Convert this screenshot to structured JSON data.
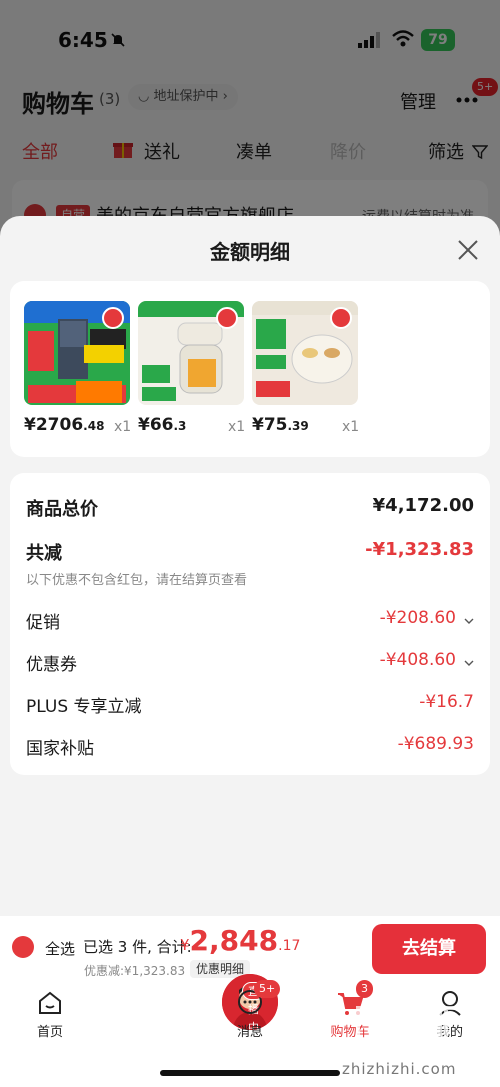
{
  "status_bar": {
    "time": "6:45",
    "battery": "79"
  },
  "cart_header": {
    "title": "购物车",
    "count": "(3)",
    "address_protect": "◡ 地址保护中 ›",
    "manage": "管理",
    "more_badge": "5+"
  },
  "filter_tabs": {
    "all": "全部",
    "gift": "送礼",
    "bundle": "凑单",
    "price_drop": "降价",
    "filter": "筛选"
  },
  "store": {
    "tag": "自营",
    "name": "美的京东自营官方旗舰店",
    "shipping": "运费以结算时为准"
  },
  "sheet": {
    "title": "金额明细",
    "products": [
      {
        "price_int": "¥2706",
        "price_dec": ".48",
        "qty": "x1"
      },
      {
        "price_int": "¥66",
        "price_dec": ".3",
        "qty": "x1"
      },
      {
        "price_int": "¥75",
        "price_dec": ".39",
        "qty": "x1"
      }
    ],
    "details": {
      "total_label": "商品总价",
      "total_value": "¥4,172.00",
      "reduce_label": "共减",
      "reduce_value": "-¥1,323.83",
      "note": "以下优惠不包含红包，请在结算页查看",
      "promo_label": "促销",
      "promo_value": "-¥208.60",
      "coupon_label": "优惠券",
      "coupon_value": "-¥408.60",
      "plus_label": "PLUS 专享立减",
      "plus_value": "-¥16.7",
      "subsidy_label": "国家补贴",
      "subsidy_value": "-¥689.93"
    }
  },
  "checkout": {
    "select_all": "全选",
    "selected": "已选 3 件, 合计:",
    "total_currency": "¥",
    "total_int": "2,848",
    "total_dec": ".17",
    "discount": "优惠减:¥1,323.83",
    "detail_button": "优惠明细",
    "submit": "去结算"
  },
  "tabbar": {
    "home": "首页",
    "live": "直播中",
    "messages": "消息",
    "messages_badge": "5+",
    "cart": "购物车",
    "cart_badge": "3",
    "mine": "我的"
  },
  "watermark": "zhizhizhi.com",
  "colors": {
    "accent": "#e4393c",
    "sheet_bg": "#f3f3f3",
    "checkout_btn": "#e5303a"
  }
}
